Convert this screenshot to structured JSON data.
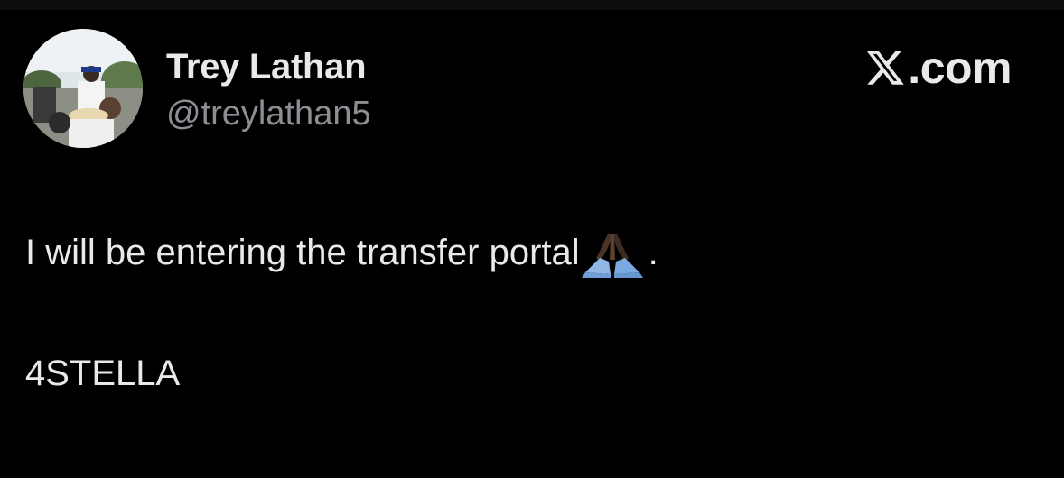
{
  "author": {
    "display_name": "Trey Lathan",
    "handle": "@treylathan5"
  },
  "brand": {
    "icon": "x-logo-icon",
    "label": ".com"
  },
  "tweet": {
    "text_before_emoji": "I will be entering the transfer portal",
    "emoji": "folded-hands-icon",
    "text_after_emoji": ".",
    "line2": "4STELLA"
  },
  "colors": {
    "background": "#000000",
    "text_primary": "#e7e9ea",
    "text_secondary": "#8b8f93"
  }
}
